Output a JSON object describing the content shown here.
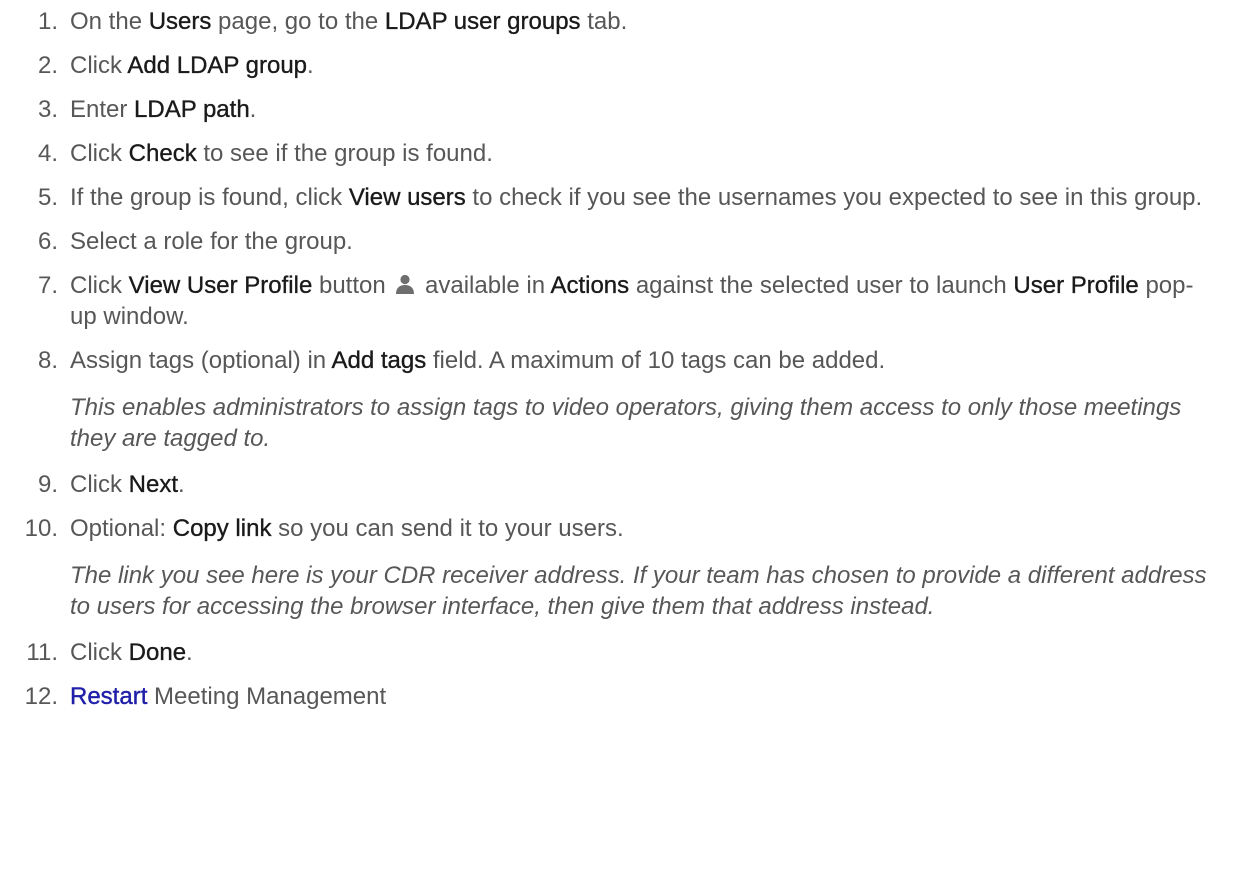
{
  "steps": [
    {
      "num": "1.",
      "parts": [
        {
          "t": "On the "
        },
        {
          "t": "Users",
          "s": "b"
        },
        {
          "t": " page, go to the "
        },
        {
          "t": "LDAP user groups",
          "s": "b"
        },
        {
          "t": " tab."
        }
      ]
    },
    {
      "num": "2.",
      "parts": [
        {
          "t": "Click "
        },
        {
          "t": "Add LDAP group",
          "s": "b"
        },
        {
          "t": "."
        }
      ]
    },
    {
      "num": "3.",
      "parts": [
        {
          "t": "Enter "
        },
        {
          "t": "LDAP path",
          "s": "b"
        },
        {
          "t": "."
        }
      ]
    },
    {
      "num": "4.",
      "parts": [
        {
          "t": "Click "
        },
        {
          "t": "Check",
          "s": "b"
        },
        {
          "t": " to see if the group is found."
        }
      ]
    },
    {
      "num": "5.",
      "parts": [
        {
          "t": "If the group is found, click "
        },
        {
          "t": "View users",
          "s": "b"
        },
        {
          "t": " to check if you see the usernames you expected to see in this group."
        }
      ]
    },
    {
      "num": "6.",
      "parts": [
        {
          "t": "Select a role for the group."
        }
      ]
    },
    {
      "num": "7.",
      "parts": [
        {
          "t": "Click "
        },
        {
          "t": "View User Profile",
          "s": "b"
        },
        {
          "t": " button "
        },
        {
          "icon": "user-profile-icon"
        },
        {
          "t": " available in "
        },
        {
          "t": "Actions",
          "s": "b"
        },
        {
          "t": " against the selected user to launch "
        },
        {
          "t": "User Profile",
          "s": "b"
        },
        {
          "t": " pop-up window."
        }
      ]
    },
    {
      "num": "8.",
      "parts": [
        {
          "t": "Assign tags (optional) in "
        },
        {
          "t": "Add tags",
          "s": "b"
        },
        {
          "t": " field. A maximum of 10 tags can be added."
        }
      ],
      "note": " This enables administrators to assign tags to video operators, giving them access to only those meetings they are tagged to."
    },
    {
      "num": "9.",
      "parts": [
        {
          "t": "Click "
        },
        {
          "t": "Next",
          "s": "b"
        },
        {
          "t": "."
        }
      ]
    },
    {
      "num": "10.",
      "parts": [
        {
          "t": "Optional: "
        },
        {
          "t": "Copy link",
          "s": "b"
        },
        {
          "t": " so you can send it to your users."
        }
      ],
      "note": "The link you see here is your CDR receiver address. If your team has chosen to provide a different address to users for accessing the browser interface, then give them that address instead."
    },
    {
      "num": "11.",
      "parts": [
        {
          "t": "Click "
        },
        {
          "t": "Done",
          "s": "b"
        },
        {
          "t": "."
        }
      ]
    },
    {
      "num": "12.",
      "parts": [
        {
          "t": "Restart",
          "s": "link"
        },
        {
          "t": " Meeting Management"
        }
      ]
    }
  ],
  "colors": {
    "text": "#575757",
    "emphasis": "#1a1a1a",
    "link": "#1f1fa8",
    "icon": "#6e6e6e"
  }
}
